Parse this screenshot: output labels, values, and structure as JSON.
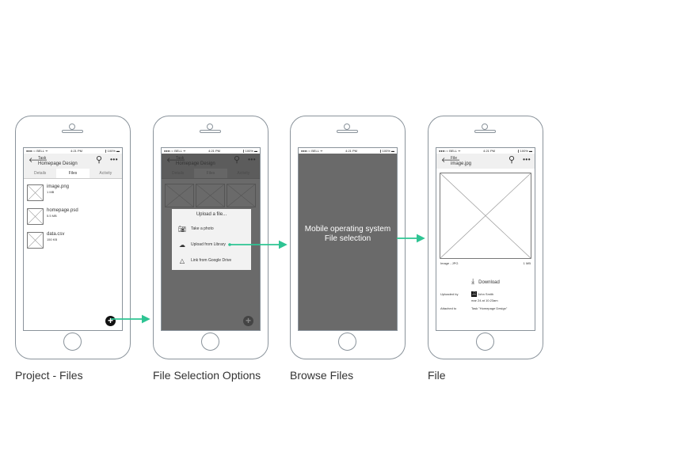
{
  "status": {
    "carrier": "●●●○○ BELL ᯤ",
    "time": "4:21 PM",
    "battery": "∦ 100% ▬"
  },
  "screen1": {
    "header_sub": "Task",
    "header_title": "Homepage Design",
    "tabs": [
      "Details",
      "Files",
      "Activity"
    ],
    "files": [
      {
        "name": "image.png",
        "size": "1 MB"
      },
      {
        "name": "homepage.psd",
        "size": "5.5 MB"
      },
      {
        "name": "data.csv",
        "size": "150 KB"
      }
    ]
  },
  "screen2": {
    "header_sub": "Task",
    "header_title": "Homepage Design",
    "tabs": [
      "Details",
      "Files",
      "Activity"
    ],
    "popup_title": "Upload a file...",
    "options": [
      "Take a photo",
      "Upload from Library",
      "Link from Google Drive"
    ]
  },
  "screen3": {
    "line1": "Mobile operating system",
    "line2": "File selection"
  },
  "screen4": {
    "header_sub": "File",
    "header_title": "image.jpg",
    "meta_type": "Image - JPG",
    "meta_size": "1 MB",
    "download": "Download",
    "uploaded_by_label": "Uploaded by",
    "uploaded_by": "John Smith",
    "uploaded_date": "mar 24 at 10:23am",
    "attached_to_label": "Attached to",
    "attached_to": "Task \"Homepage Design\""
  },
  "captions": [
    "Project - Files",
    "File Selection Options",
    "Browse Files",
    "File"
  ],
  "colors": {
    "arrow": "#2ec493",
    "overlay": "#6a6a6a",
    "outline": "#8a939b"
  }
}
